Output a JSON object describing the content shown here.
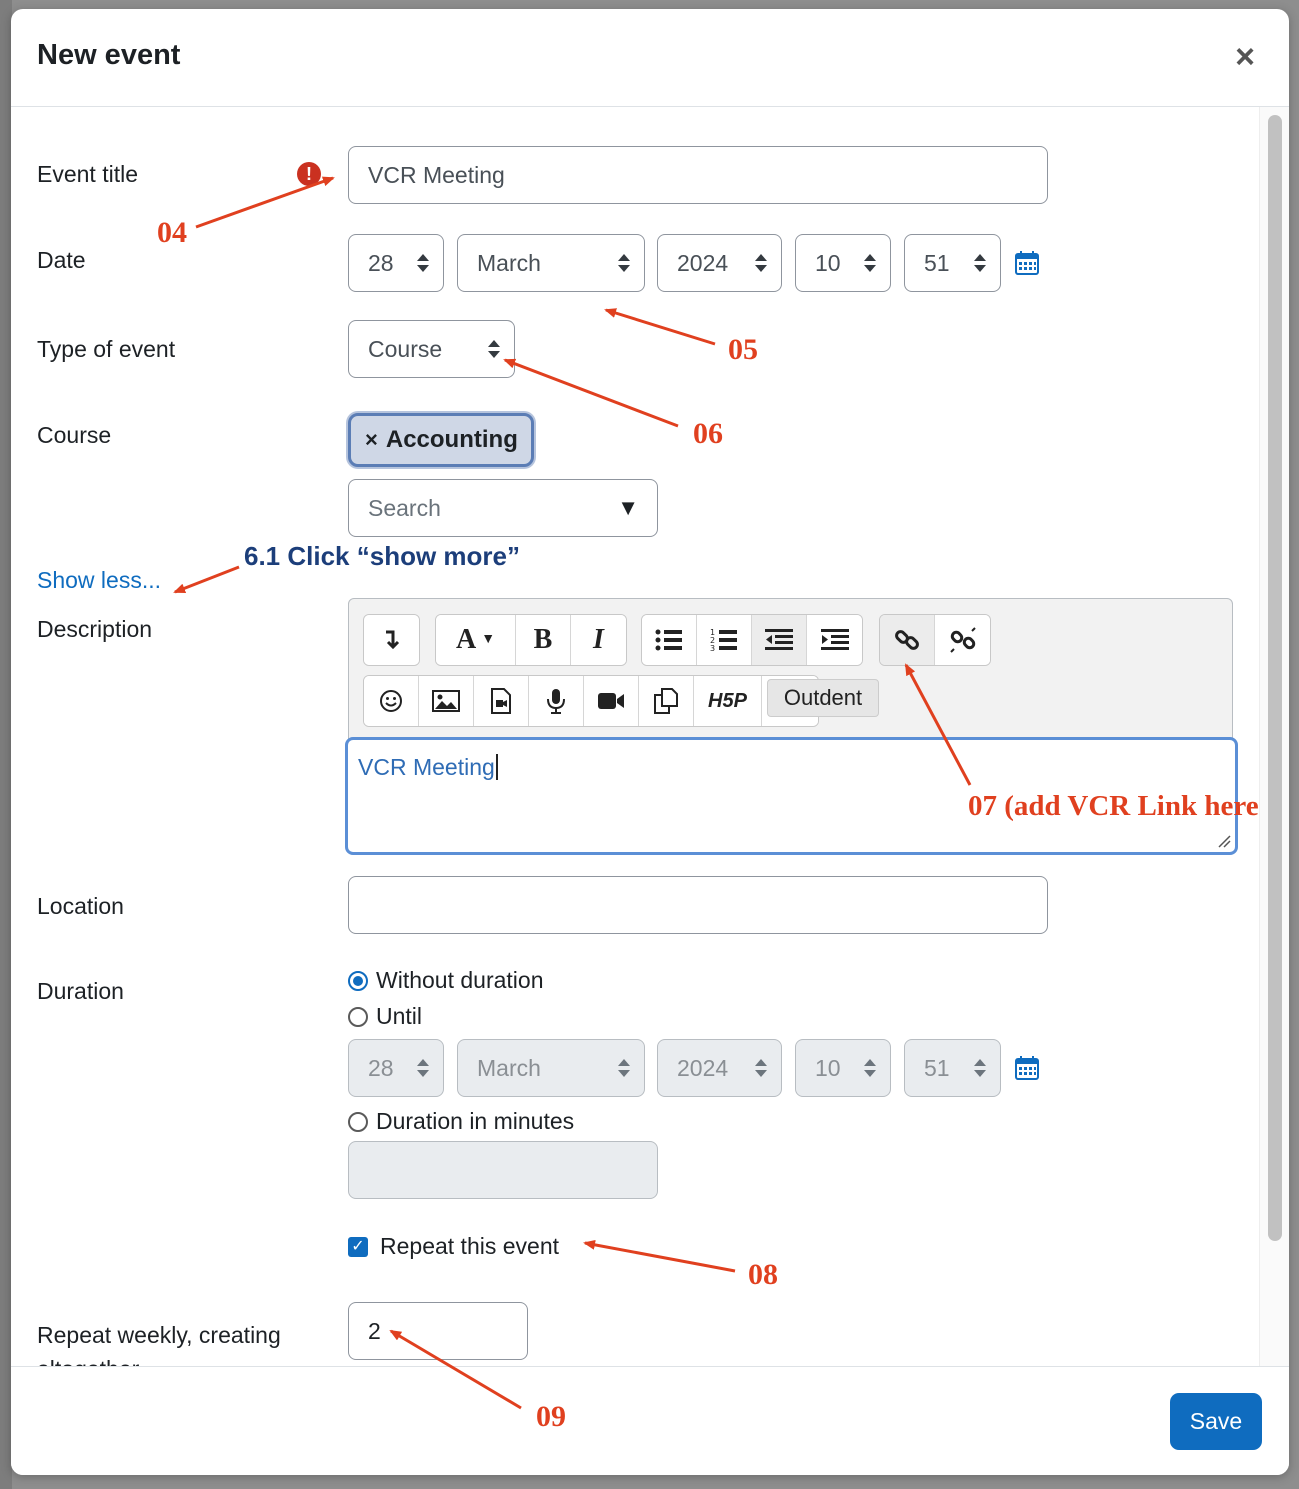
{
  "modal": {
    "title": "New event",
    "close_symbol": "×"
  },
  "form": {
    "event_title": {
      "label": "Event title",
      "value": "VCR Meeting",
      "error_symbol": "!"
    },
    "date": {
      "label": "Date",
      "day": "28",
      "month": "March",
      "year": "2024",
      "hour": "10",
      "minute": "51"
    },
    "type_of_event": {
      "label": "Type of event",
      "value": "Course"
    },
    "course": {
      "label": "Course",
      "selected_chip": "Accounting",
      "chip_remove_symbol": "×",
      "search_placeholder": "Search",
      "dropdown_symbol": "▼"
    },
    "show_less_link": "Show less...",
    "description": {
      "label": "Description",
      "content": "VCR Meeting",
      "tooltip": "Outdent",
      "toolbar_row1": [
        [
          "collapse-icon"
        ],
        [
          "font-style-icon",
          "bold-icon",
          "italic-icon"
        ],
        [
          "unordered-list-icon",
          "ordered-list-icon",
          "outdent-icon",
          "indent-icon"
        ],
        [
          "link-icon",
          "unlink-icon"
        ]
      ],
      "toolbar_row2": [
        "emoji-icon",
        "image-icon",
        "media-icon",
        "record-audio-icon",
        "record-video-icon",
        "manage-files-icon",
        "h5p-icon"
      ],
      "toolbar_text": {
        "font_style": "A",
        "bold": "B",
        "italic": "I",
        "h5p": "H5P"
      }
    },
    "location": {
      "label": "Location",
      "value": ""
    },
    "duration": {
      "label": "Duration",
      "options": {
        "without_duration": "Without duration",
        "until": "Until",
        "in_minutes": "Duration in minutes"
      },
      "selected": "without_duration",
      "until_date": {
        "day": "28",
        "month": "March",
        "year": "2024",
        "hour": "10",
        "minute": "51"
      },
      "minutes_value": ""
    },
    "repeat": {
      "label": "Repeat this event",
      "checked": true,
      "check_symbol": "✓"
    },
    "repeat_weekly": {
      "label": "Repeat weekly, creating altogether",
      "value": "2"
    }
  },
  "footer": {
    "save_label": "Save"
  },
  "annotations": {
    "a04": "04",
    "a05": "05",
    "a06": "06",
    "a61": "6.1 Click “show more”",
    "a07": "07 (add VCR Link here",
    "a08": "08",
    "a09": "09"
  },
  "colors": {
    "accent": "#0f6cbf",
    "annotation_red": "#e0401f",
    "annotation_blue": "#1c3e7a",
    "error": "#ca3120"
  }
}
